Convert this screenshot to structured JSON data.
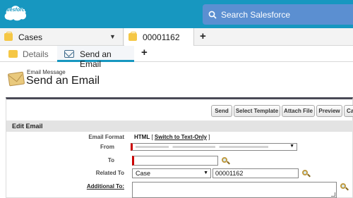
{
  "header": {
    "logo_text": "salesforce",
    "search_placeholder": "Search Salesforce"
  },
  "workspace_tabs": [
    {
      "label": "Cases"
    },
    {
      "label": "00001162"
    }
  ],
  "subtabs": [
    {
      "label": "Details"
    },
    {
      "label": "Send an Email"
    }
  ],
  "page": {
    "subtitle": "Email Message",
    "title": "Send an Email"
  },
  "toolbar": {
    "send": "Send",
    "select_template": "Select Template",
    "attach_file": "Attach File",
    "preview": "Preview",
    "cancel": "Canc"
  },
  "section": {
    "title": "Edit Email"
  },
  "form": {
    "email_format_label": "Email Format",
    "email_format_value": "HTML",
    "switch_prefix": "[ ",
    "switch_link": "Switch to Text-Only",
    "switch_suffix": " ]",
    "from_label": "From",
    "to_label": "To",
    "to_value": "",
    "related_label": "Related To",
    "related_type": "Case",
    "related_value": "00001162",
    "additional_label": "Additional To:",
    "additional_value": ""
  },
  "colors": {
    "header": "#1797c0",
    "search": "#5b8fd1",
    "required": "#cc0000"
  }
}
